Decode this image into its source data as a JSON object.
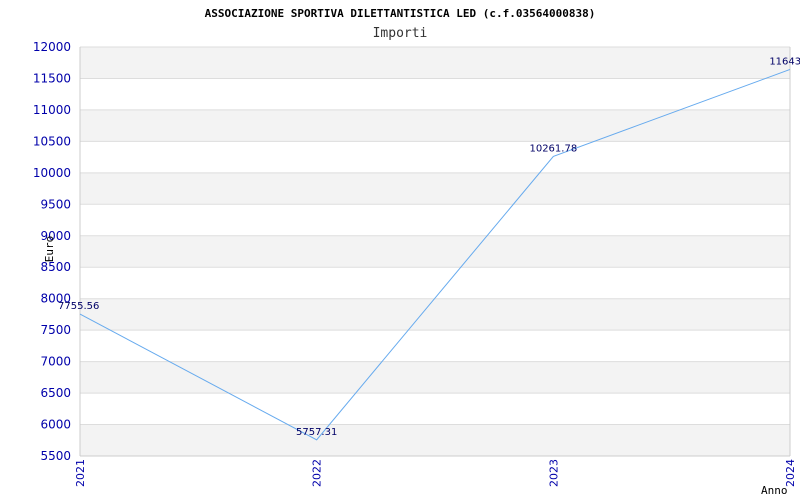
{
  "chart_data": {
    "type": "line",
    "title": "ASSOCIAZIONE SPORTIVA DILETTANTISTICA LED (c.f.03564000838)",
    "subtitle": "Importi",
    "xlabel": "Anno",
    "ylabel": "Euro",
    "categories": [
      "2021",
      "2022",
      "2023",
      "2024"
    ],
    "series": [
      {
        "values": [
          7755.56,
          5757.31,
          10261.78,
          11643.0
        ],
        "labels": [
          "7755.56",
          "5757.31",
          "10261.78",
          "11643.0"
        ]
      }
    ],
    "ylim": [
      5500,
      12000
    ],
    "yticks": [
      5500,
      6000,
      6500,
      7000,
      7500,
      8000,
      8500,
      9000,
      9500,
      10000,
      10500,
      11000,
      11500,
      12000
    ],
    "grid": true,
    "colors": {
      "line": "#66aaee",
      "band": "#f3f3f3",
      "grid": "#dddddd",
      "tick_text": "#0000aa",
      "data_text": "#000066"
    }
  }
}
